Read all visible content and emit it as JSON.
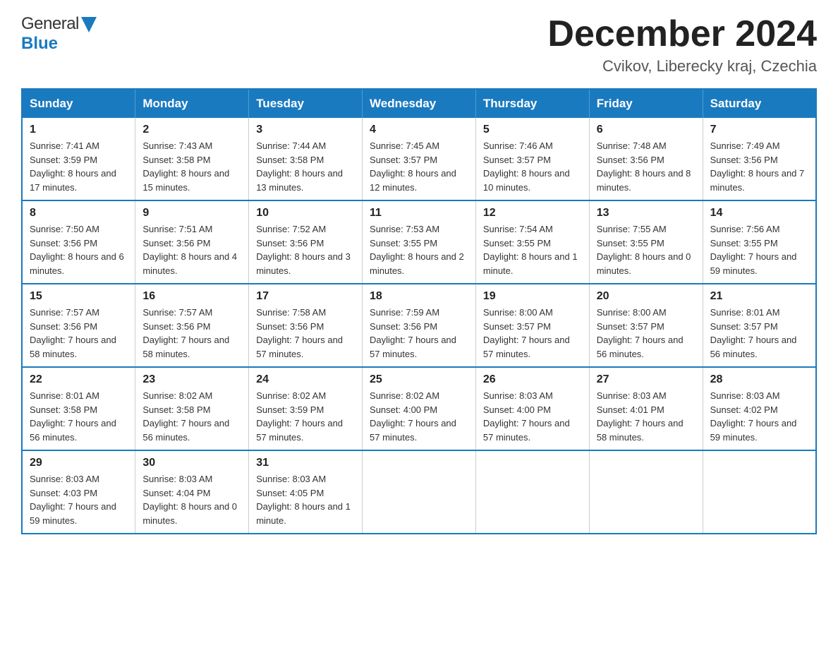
{
  "header": {
    "logo_general": "General",
    "logo_blue": "Blue",
    "month_title": "December 2024",
    "subtitle": "Cvikov, Liberecky kraj, Czechia"
  },
  "days_of_week": [
    "Sunday",
    "Monday",
    "Tuesday",
    "Wednesday",
    "Thursday",
    "Friday",
    "Saturday"
  ],
  "weeks": [
    [
      {
        "day": "1",
        "sunrise": "7:41 AM",
        "sunset": "3:59 PM",
        "daylight": "8 hours and 17 minutes."
      },
      {
        "day": "2",
        "sunrise": "7:43 AM",
        "sunset": "3:58 PM",
        "daylight": "8 hours and 15 minutes."
      },
      {
        "day": "3",
        "sunrise": "7:44 AM",
        "sunset": "3:58 PM",
        "daylight": "8 hours and 13 minutes."
      },
      {
        "day": "4",
        "sunrise": "7:45 AM",
        "sunset": "3:57 PM",
        "daylight": "8 hours and 12 minutes."
      },
      {
        "day": "5",
        "sunrise": "7:46 AM",
        "sunset": "3:57 PM",
        "daylight": "8 hours and 10 minutes."
      },
      {
        "day": "6",
        "sunrise": "7:48 AM",
        "sunset": "3:56 PM",
        "daylight": "8 hours and 8 minutes."
      },
      {
        "day": "7",
        "sunrise": "7:49 AM",
        "sunset": "3:56 PM",
        "daylight": "8 hours and 7 minutes."
      }
    ],
    [
      {
        "day": "8",
        "sunrise": "7:50 AM",
        "sunset": "3:56 PM",
        "daylight": "8 hours and 6 minutes."
      },
      {
        "day": "9",
        "sunrise": "7:51 AM",
        "sunset": "3:56 PM",
        "daylight": "8 hours and 4 minutes."
      },
      {
        "day": "10",
        "sunrise": "7:52 AM",
        "sunset": "3:56 PM",
        "daylight": "8 hours and 3 minutes."
      },
      {
        "day": "11",
        "sunrise": "7:53 AM",
        "sunset": "3:55 PM",
        "daylight": "8 hours and 2 minutes."
      },
      {
        "day": "12",
        "sunrise": "7:54 AM",
        "sunset": "3:55 PM",
        "daylight": "8 hours and 1 minute."
      },
      {
        "day": "13",
        "sunrise": "7:55 AM",
        "sunset": "3:55 PM",
        "daylight": "8 hours and 0 minutes."
      },
      {
        "day": "14",
        "sunrise": "7:56 AM",
        "sunset": "3:55 PM",
        "daylight": "7 hours and 59 minutes."
      }
    ],
    [
      {
        "day": "15",
        "sunrise": "7:57 AM",
        "sunset": "3:56 PM",
        "daylight": "7 hours and 58 minutes."
      },
      {
        "day": "16",
        "sunrise": "7:57 AM",
        "sunset": "3:56 PM",
        "daylight": "7 hours and 58 minutes."
      },
      {
        "day": "17",
        "sunrise": "7:58 AM",
        "sunset": "3:56 PM",
        "daylight": "7 hours and 57 minutes."
      },
      {
        "day": "18",
        "sunrise": "7:59 AM",
        "sunset": "3:56 PM",
        "daylight": "7 hours and 57 minutes."
      },
      {
        "day": "19",
        "sunrise": "8:00 AM",
        "sunset": "3:57 PM",
        "daylight": "7 hours and 57 minutes."
      },
      {
        "day": "20",
        "sunrise": "8:00 AM",
        "sunset": "3:57 PM",
        "daylight": "7 hours and 56 minutes."
      },
      {
        "day": "21",
        "sunrise": "8:01 AM",
        "sunset": "3:57 PM",
        "daylight": "7 hours and 56 minutes."
      }
    ],
    [
      {
        "day": "22",
        "sunrise": "8:01 AM",
        "sunset": "3:58 PM",
        "daylight": "7 hours and 56 minutes."
      },
      {
        "day": "23",
        "sunrise": "8:02 AM",
        "sunset": "3:58 PM",
        "daylight": "7 hours and 56 minutes."
      },
      {
        "day": "24",
        "sunrise": "8:02 AM",
        "sunset": "3:59 PM",
        "daylight": "7 hours and 57 minutes."
      },
      {
        "day": "25",
        "sunrise": "8:02 AM",
        "sunset": "4:00 PM",
        "daylight": "7 hours and 57 minutes."
      },
      {
        "day": "26",
        "sunrise": "8:03 AM",
        "sunset": "4:00 PM",
        "daylight": "7 hours and 57 minutes."
      },
      {
        "day": "27",
        "sunrise": "8:03 AM",
        "sunset": "4:01 PM",
        "daylight": "7 hours and 58 minutes."
      },
      {
        "day": "28",
        "sunrise": "8:03 AM",
        "sunset": "4:02 PM",
        "daylight": "7 hours and 59 minutes."
      }
    ],
    [
      {
        "day": "29",
        "sunrise": "8:03 AM",
        "sunset": "4:03 PM",
        "daylight": "7 hours and 59 minutes."
      },
      {
        "day": "30",
        "sunrise": "8:03 AM",
        "sunset": "4:04 PM",
        "daylight": "8 hours and 0 minutes."
      },
      {
        "day": "31",
        "sunrise": "8:03 AM",
        "sunset": "4:05 PM",
        "daylight": "8 hours and 1 minute."
      },
      null,
      null,
      null,
      null
    ]
  ],
  "labels": {
    "sunrise": "Sunrise:",
    "sunset": "Sunset:",
    "daylight": "Daylight:"
  }
}
